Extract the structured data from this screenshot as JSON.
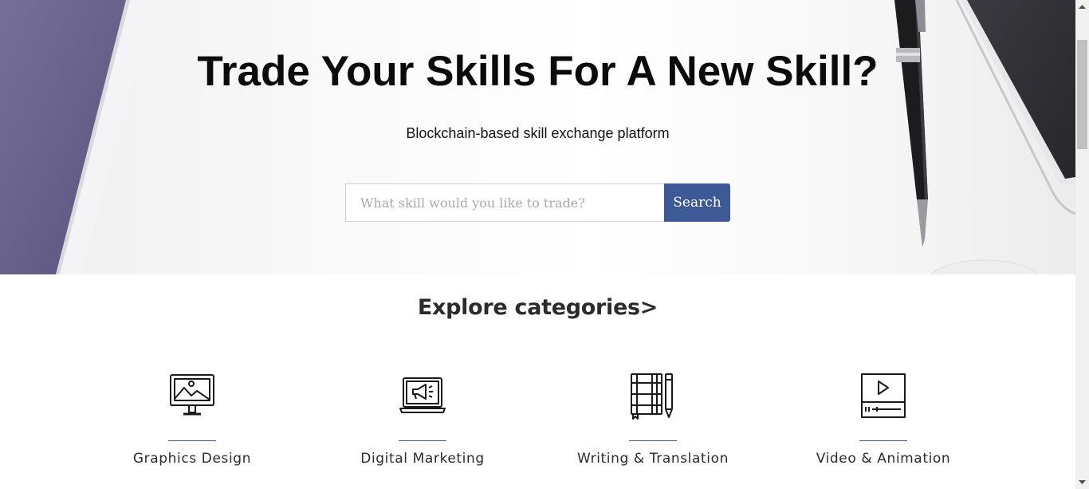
{
  "hero": {
    "title": "Trade Your Skills For A New Skill?",
    "subtitle": "Blockchain-based skill exchange platform",
    "search": {
      "placeholder": "What skill would you like to trade?",
      "value": "",
      "button_label": "Search"
    }
  },
  "categories_section": {
    "title": "Explore categories>",
    "items": [
      {
        "label": "Graphics Design",
        "icon": "monitor-image-icon"
      },
      {
        "label": "Digital Marketing",
        "icon": "laptop-megaphone-icon"
      },
      {
        "label": "Writing & Translation",
        "icon": "notebook-pen-icon"
      },
      {
        "label": "Video & Animation",
        "icon": "video-player-icon"
      }
    ]
  },
  "colors": {
    "accent": "#3d5a96",
    "hero_purple": "#6a6495",
    "text_dark": "#0b0b0b"
  }
}
